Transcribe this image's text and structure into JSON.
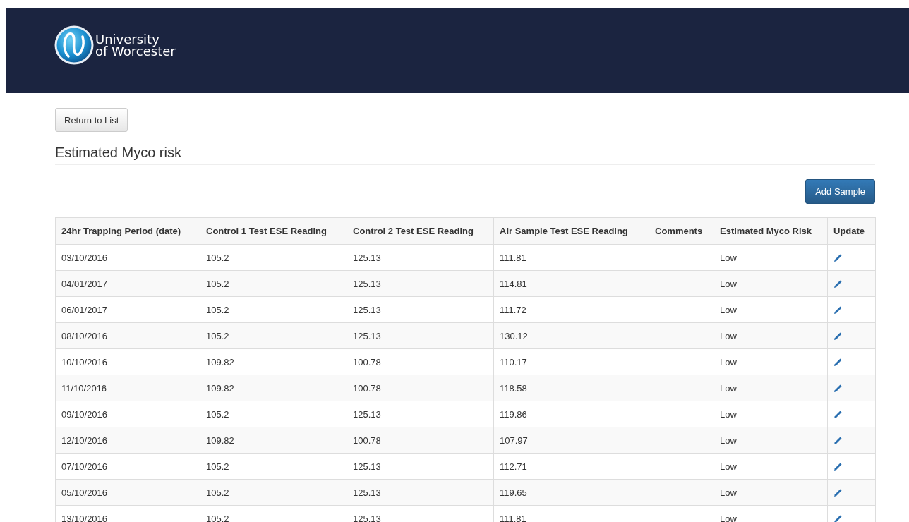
{
  "header": {
    "logo_lines": [
      "University",
      "of Worcester"
    ]
  },
  "return_button": "Return to List",
  "title": "Estimated Myco risk",
  "add_button": "Add Sample",
  "table": {
    "columns": [
      "24hr Trapping Period (date)",
      "Control 1 Test ESE Reading",
      "Control 2 Test ESE Reading",
      "Air Sample Test ESE Reading",
      "Comments",
      "Estimated Myco Risk",
      "Update"
    ],
    "rows": [
      {
        "date": "03/10/2016",
        "control_1": "105.2",
        "control_2": "125.13",
        "air_sample": "111.81",
        "risk": "Low"
      },
      {
        "date": "04/01/2017",
        "control_1": "105.2",
        "control_2": "125.13",
        "air_sample": "114.81",
        "risk": "Low"
      },
      {
        "date": "06/01/2017",
        "control_1": "105.2",
        "control_2": "125.13",
        "air_sample": "111.72",
        "risk": "Low"
      },
      {
        "date": "08/10/2016",
        "control_1": "105.2",
        "control_2": "125.13",
        "air_sample": "130.12",
        "risk": "Low"
      },
      {
        "date": "10/10/2016",
        "control_1": "109.82",
        "control_2": "100.78",
        "air_sample": "110.17",
        "risk": "Low"
      },
      {
        "date": "11/10/2016",
        "control_1": "109.82",
        "control_2": "100.78",
        "air_sample": "118.58",
        "risk": "Low"
      },
      {
        "date": "09/10/2016",
        "control_1": "105.2",
        "control_2": "125.13",
        "air_sample": "119.86",
        "risk": "Low"
      },
      {
        "date": "12/10/2016",
        "control_1": "109.82",
        "control_2": "100.78",
        "air_sample": "107.97",
        "risk": "Low"
      },
      {
        "date": "07/10/2016",
        "control_1": "105.2",
        "control_2": "125.13",
        "air_sample": "112.71",
        "risk": "Low"
      },
      {
        "date": "05/10/2016",
        "control_1": "105.2",
        "control_2": "125.13",
        "air_sample": "119.65",
        "risk": "Low"
      },
      {
        "date": "13/10/2016",
        "control_1": "105.2",
        "control_2": "125.13",
        "air_sample": "111.81",
        "risk": "Low"
      }
    ]
  }
}
